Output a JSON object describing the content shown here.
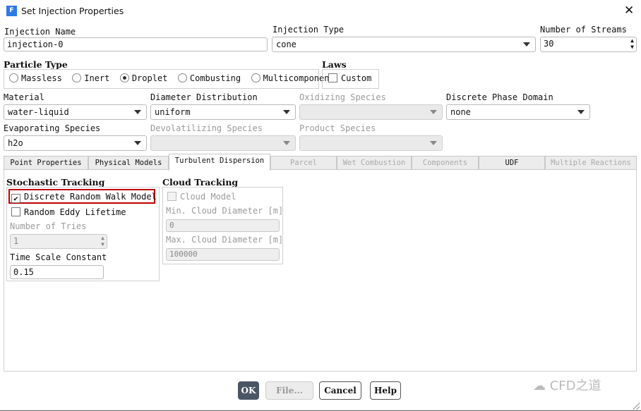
{
  "window": {
    "title": "Set Injection Properties",
    "app_icon_letter": "F"
  },
  "injection_name": {
    "label": "Injection Name",
    "value": "injection-0"
  },
  "injection_type": {
    "label": "Injection Type",
    "value": "cone"
  },
  "num_streams": {
    "label": "Number of Streams",
    "value": "30"
  },
  "particle_type": {
    "label": "Particle Type",
    "options": [
      "Massless",
      "Inert",
      "Droplet",
      "Combusting",
      "Multicomponent"
    ],
    "selected": "Droplet"
  },
  "laws": {
    "label": "Laws",
    "custom_label": "Custom",
    "custom_checked": false
  },
  "material": {
    "label": "Material",
    "value": "water-liquid"
  },
  "diameter_distribution": {
    "label": "Diameter Distribution",
    "value": "uniform"
  },
  "oxidizing_species": {
    "label": "Oxidizing Species",
    "value": ""
  },
  "discrete_phase_domain": {
    "label": "Discrete Phase Domain",
    "value": "none"
  },
  "evaporating_species": {
    "label": "Evaporating Species",
    "value": "h2o"
  },
  "devolatilizing_species": {
    "label": "Devolatilizing Species",
    "value": ""
  },
  "product_species": {
    "label": "Product Species",
    "value": ""
  },
  "tabs": [
    {
      "label": "Point Properties"
    },
    {
      "label": "Physical Models"
    },
    {
      "label": "Turbulent Dispersion",
      "active": true
    },
    {
      "label": "Parcel",
      "disabled": true
    },
    {
      "label": "Wet Combustion",
      "disabled": true
    },
    {
      "label": "Components",
      "disabled": true
    },
    {
      "label": "UDF"
    },
    {
      "label": "Multiple Reactions",
      "disabled": true
    }
  ],
  "stochastic": {
    "title": "Stochastic Tracking",
    "drw_label": "Discrete Random Walk Model",
    "drw_checked": true,
    "eddy_label": "Random Eddy Lifetime",
    "eddy_checked": false,
    "tries_label": "Number of Tries",
    "tries_value": "1",
    "tsc_label": "Time Scale Constant",
    "tsc_value": "0.15"
  },
  "cloud": {
    "title": "Cloud Tracking",
    "model_label": "Cloud Model",
    "min_label": "Min. Cloud Diameter [m]",
    "min_value": "0",
    "max_label": "Max. Cloud Diameter [m]",
    "max_value": "100000"
  },
  "buttons": {
    "ok": "OK",
    "file": "File...",
    "cancel": "Cancel",
    "help": "Help"
  },
  "watermark": "CFD之道",
  "colors": {
    "highlight": "#c00000",
    "ok_button": "#4a5565",
    "app_icon": "#2f7ae5"
  }
}
